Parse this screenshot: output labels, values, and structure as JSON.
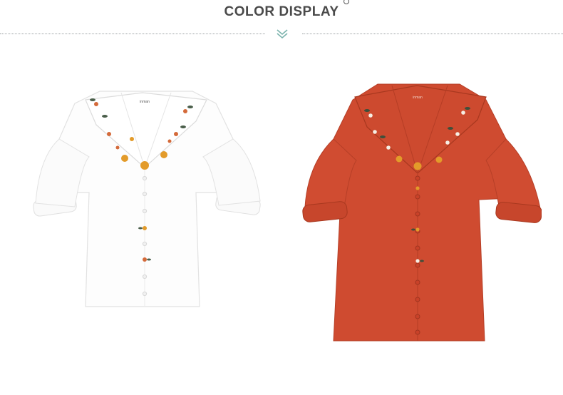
{
  "header": {
    "title": "COLOR DISPLAY",
    "divider_icon": "chevron-down-double-icon",
    "accent_color": "#7bb3ad"
  },
  "products": [
    {
      "name": "white-blouse",
      "shirt_color": "#fdfdfd",
      "trim_color": "#e8e8e8",
      "label_text": "inman"
    },
    {
      "name": "red-blouse",
      "shirt_color": "#cf4b30",
      "trim_color": "#b53d25",
      "label_text": "inman"
    }
  ]
}
